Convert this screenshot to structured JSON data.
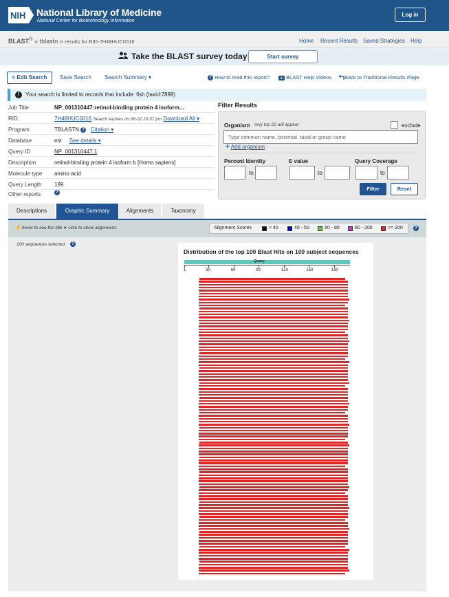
{
  "header": {
    "logo": "NIH",
    "title": "National Library of Medicine",
    "subtitle": "National Center for Biotechnology Information",
    "login": "Log in"
  },
  "nav": {
    "blast": "BLAST",
    "reg": "®",
    "sep": "»",
    "program": "tblastn",
    "results_for": "results for RID-7H48HUC0016",
    "home": "Home",
    "recent": "Recent Results",
    "saved": "Saved Strategies",
    "help": "Help"
  },
  "survey": {
    "text": "Take the BLAST survey today",
    "button": "Start survey"
  },
  "toolbar": {
    "edit": "< Edit Search",
    "save": "Save Search",
    "summary": "Search Summary ▾",
    "how_to": "How to read this report?",
    "videos": "BLAST Help Videos",
    "back": "Back to Traditional Results Page"
  },
  "notice": {
    "text": "Your search is limited to records that include: fish (taxid:7898)"
  },
  "job": {
    "job_title_label": "Job Title",
    "job_title": "NP_001310447:retinol-binding protein 4 isoform...",
    "rid_label": "RID",
    "rid": "7H48HUC0016",
    "expires": "Search expires on 06-02 20:37 pm",
    "download": "Download All ▾",
    "program_label": "Program",
    "program": "TBLASTN",
    "citation": "Citation ▾",
    "database_label": "Database",
    "database": "est",
    "see_details": "See details ▾",
    "query_id_label": "Query ID",
    "query_id": "NP_001310447.1",
    "description_label": "Description",
    "description": "retinol-binding protein 4 isoform b [Homo sapiens]",
    "molecule_label": "Molecule type",
    "molecule": "amino acid",
    "length_label": "Query Length",
    "length": "199",
    "other_label": "Other reports"
  },
  "filter": {
    "title": "Filter Results",
    "organism": "Organism",
    "organism_hint": "only top 20 will appear",
    "exclude": "exclude",
    "organism_placeholder": "Type common  name, binomial, taxid or group  name",
    "add_organism": "Add organism",
    "percent_identity": "Percent Identity",
    "e_value": "E value",
    "query_coverage": "Query Coverage",
    "to": "to",
    "filter_btn": "Filter",
    "reset_btn": "Reset"
  },
  "tabs": [
    "Descriptions",
    "Graphic Summary",
    "Alignments",
    "Taxonomy"
  ],
  "graphic": {
    "hover_hint": "hover to see the title",
    "click_hint": "click to show alignments",
    "scores_label": "Alignment Scores",
    "score_legend": [
      {
        "label": "< 40",
        "color": "#000000"
      },
      {
        "label": "40 - 50",
        "color": "#0000cc"
      },
      {
        "label": "50 - 80",
        "color": "#66cc33"
      },
      {
        "label": "80 - 200",
        "color": "#cc33cc"
      },
      {
        "label": ">= 200",
        "color": "#e02424"
      }
    ],
    "selected": "100 sequences selected",
    "title": "Distribution of the top 100 Blast Hits on 100 subject sequences",
    "query_label": "Query",
    "ticks": [
      "1",
      "30",
      "60",
      "90",
      "120",
      "150",
      "180"
    ],
    "hit_count": 100,
    "hit_color": "#e02424"
  }
}
